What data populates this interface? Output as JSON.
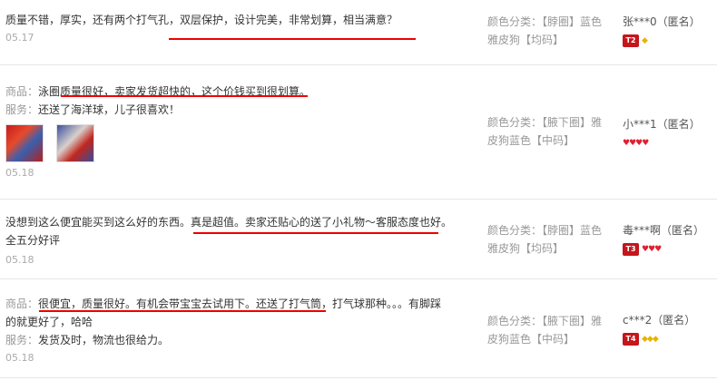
{
  "reviews": [
    {
      "lines": [
        "质量不错，厚实，还有两个打气孔，双层保护，设计完美，非常划算，相当满意？"
      ],
      "date": "05.17",
      "color_meta": "颜色分类：【脖圈】蓝色雅皮狗【均码】",
      "user": "张***0（匿名）",
      "level_badge": "T2",
      "level_icons": "◆",
      "level_color": "gold"
    },
    {
      "product_label": "商品：",
      "product_text": "泳圈质量很好，卖家发货超快的，这个价钱买到很划算。",
      "service_label": "服务：",
      "service_text": "还送了海洋球，儿子很喜欢！",
      "date": "05.18",
      "color_meta": "颜色分类：【腋下圈】雅皮狗蓝色【中码】",
      "user": "小***1（匿名）",
      "level_icons": "♥♥♥♥",
      "level_color": "red"
    },
    {
      "lines": [
        "没想到这么便宜能买到这么好的东西。真是超值。卖家还贴心的送了小礼物～客服态度也好。",
        "全五分好评"
      ],
      "date": "05.18",
      "color_meta": "颜色分类：【脖圈】蓝色雅皮狗【均码】",
      "user": "毒***啊（匿名）",
      "level_badge": "T3",
      "level_icons": "♥♥♥",
      "level_color": "red"
    },
    {
      "product_label": "商品：",
      "product_text": "很便宜，质量很好。有机会带宝宝去试用下。还送了打气筒，打气球那种。。。有脚踩",
      "product_text2": "的就更好了，哈哈",
      "service_label": "服务：",
      "service_text": "发货及时，物流也很给力。",
      "date": "05.18",
      "color_meta": "颜色分类：【腋下圈】雅皮狗蓝色【中码】",
      "user": "c***2（匿名）",
      "level_badge": "T4",
      "level_icons": "◆◆◆",
      "level_color": "gold"
    }
  ]
}
